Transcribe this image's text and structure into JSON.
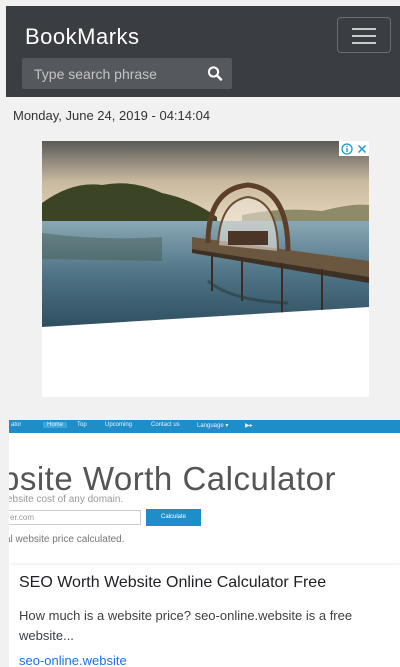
{
  "header": {
    "brand": "BookMarks",
    "search_placeholder": "Type search phrase",
    "menu_icon": "hamburger-menu-icon",
    "search_icon": "search-icon",
    "background_color": "#3a3d42"
  },
  "datetime": "Monday, June 24, 2019 - 04:14:04",
  "ad": {
    "badge_icons": [
      "info-icon",
      "close-icon"
    ],
    "image": "lake-dock-gazebo-photo"
  },
  "preview": {
    "nav_items": [
      "Home",
      "Top",
      "Upcoming",
      "Contact us",
      "Language ▾",
      "▶▸"
    ],
    "title": "bsite Worth Calculator",
    "subtitle": "ebsite cost of any domain.",
    "input_placeholder": "er.com",
    "button_label": "Calculate",
    "note": "al website price calculated.",
    "accent_color": "#1e8ec9"
  },
  "result": {
    "title": "SEO Worth Website Online Calculator Free",
    "description": "How much is a website price? seo-online.website is a free website...",
    "link": "seo-online.website"
  }
}
